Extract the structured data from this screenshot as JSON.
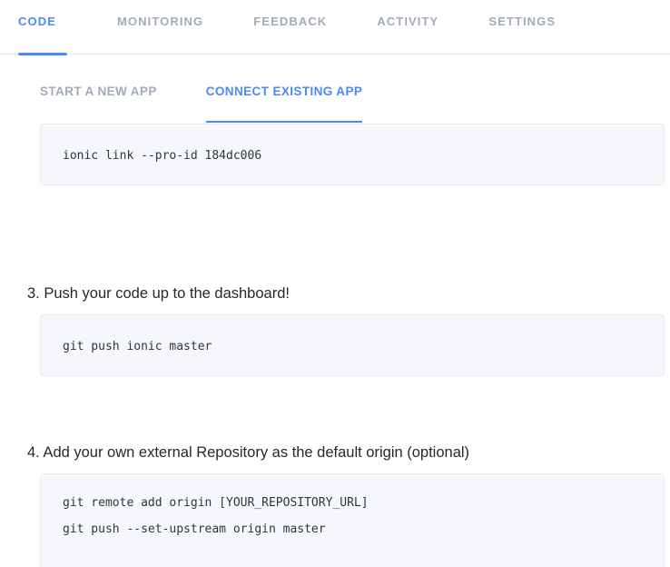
{
  "top_tabs": [
    {
      "label": "CODE",
      "active": true
    },
    {
      "label": "MONITORING",
      "active": false
    },
    {
      "label": "FEEDBACK",
      "active": false
    },
    {
      "label": "ACTIVITY",
      "active": false
    },
    {
      "label": "SETTINGS",
      "active": false
    }
  ],
  "sub_tabs": [
    {
      "label": "START A NEW APP",
      "active": false
    },
    {
      "label": "CONNECT EXISTING APP",
      "active": true
    }
  ],
  "code_blocks": {
    "link": {
      "lines": [
        "ionic link --pro-id 184dc006"
      ]
    },
    "push": {
      "lines": [
        "git push ionic master"
      ]
    },
    "remote": {
      "lines": [
        "git remote add origin [YOUR_REPOSITORY_URL]",
        "git push --set-upstream origin master"
      ]
    }
  },
  "steps": {
    "step3": "3. Push your code up to the dashboard!",
    "step4": "4. Add your own external Repository as the default origin (optional)"
  },
  "colors": {
    "accent": "#4a8af4",
    "tab_inactive": "#a2abb8",
    "code_bg": "#f5f7fa"
  }
}
